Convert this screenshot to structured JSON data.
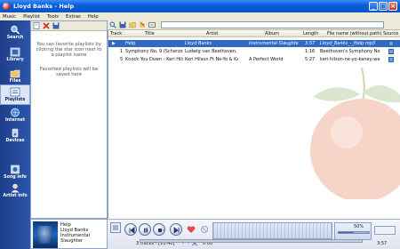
{
  "window": {
    "title": "Lloyd Banks - Help",
    "buttons": {
      "min": "_",
      "max": "□",
      "close": "×"
    }
  },
  "menu": [
    "Music",
    "Playlist",
    "Tools",
    "Extras",
    "Help"
  ],
  "nav": [
    {
      "label": "Search",
      "icon": "magnifier-icon"
    },
    {
      "label": "Library",
      "icon": "library-icon"
    },
    {
      "label": "Files",
      "icon": "folder-icon"
    },
    {
      "label": "Playlists",
      "icon": "playlist-icon"
    },
    {
      "label": "Internet",
      "icon": "globe-icon"
    },
    {
      "label": "Devices",
      "icon": "devices-icon"
    },
    {
      "label": "Song info",
      "icon": "song-info-icon"
    },
    {
      "label": "Artist info",
      "icon": "artist-info-icon"
    }
  ],
  "playlists_panel": {
    "hint1": "You can favorite playlists by clicking the star icon next to a playlist name",
    "hint2": "Favorited playlists will be saved here"
  },
  "now_playing": {
    "title": "Help",
    "artist": "Lloyd Banks",
    "album": "Instrumental Slaughter"
  },
  "columns": [
    "Track",
    "Title",
    "Artist",
    "Album",
    "Length",
    "File name (without path)",
    "Source"
  ],
  "tracks": [
    {
      "track": "",
      "title": "Help",
      "artist": "Lloyd Banks",
      "album": "Instrumental Slaughter Vol",
      "length": "3:57",
      "file": "Lloyd_Banks_-_Help.mp3",
      "playing": true
    },
    {
      "track": "1",
      "title": "Symphony No. 9 (Scherzo)",
      "artist": "Ludwig van Beethoven, conducte",
      "album": "",
      "length": "1:16",
      "file": "Beethoven's Symphony No. 9",
      "playing": false
    },
    {
      "track": "5",
      "title": "Knock You Down - Keri Hilso",
      "artist": "Keri Hilson Ft Ne-Yo & Kanye W",
      "album": "A Perfect World",
      "length": "5:27",
      "file": "keri-hilson-ne-yo-kaney-we",
      "playing": false
    }
  ],
  "status": {
    "tracks": "3 tracks - [10:40]",
    "elapsed": "0:00",
    "total": "3:57",
    "volume": "50%"
  },
  "colors": {
    "accent": "#3169c6",
    "nav": "#2c56ab"
  }
}
